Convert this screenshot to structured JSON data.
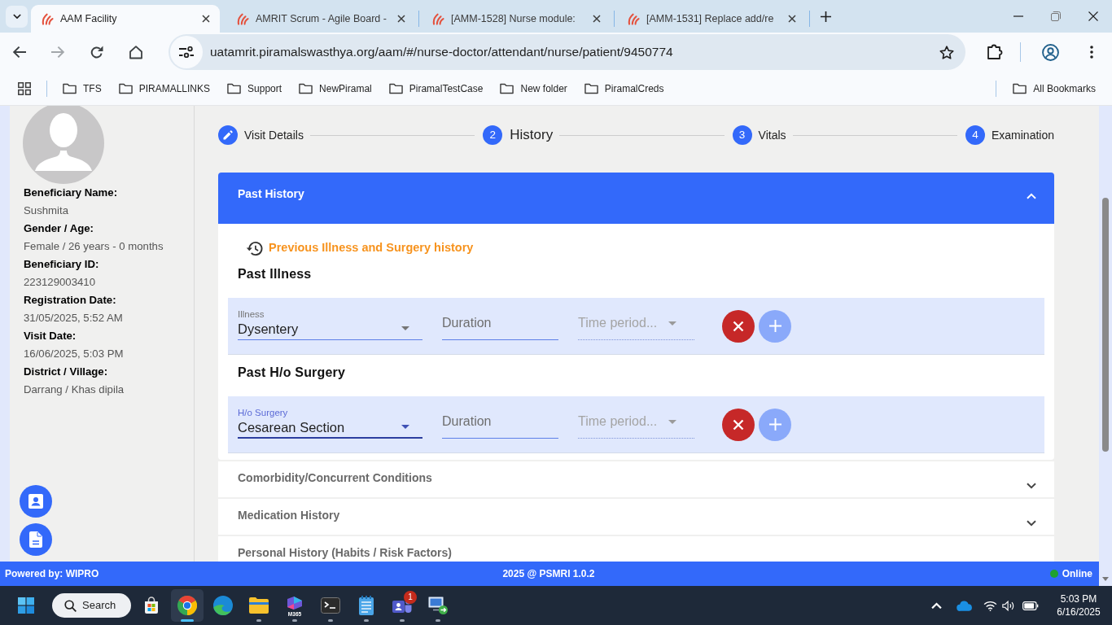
{
  "browser": {
    "tabs": [
      {
        "title": "AAM Facility",
        "selected": true
      },
      {
        "title": "AMRIT Scrum - Agile Board -",
        "selected": false
      },
      {
        "title": "[AMM-1528] Nurse module:",
        "selected": false
      },
      {
        "title": "[AMM-1531] Replace add/re",
        "selected": false
      }
    ],
    "nav_buttons": [
      {
        "kind": "back",
        "disabled": false
      },
      {
        "kind": "forward",
        "disabled": true
      },
      {
        "kind": "reload",
        "disabled": false
      },
      {
        "kind": "home",
        "disabled": false
      }
    ],
    "address": "uatamrit.piramalswasthya.org/aam/#/nurse-doctor/attendant/nurse/patient/9450774",
    "bookmarks": [
      "TFS",
      "PIRAMALLINKS",
      "Support",
      "NewPiramal",
      "PiramalTestCase",
      "New folder",
      "PiramalCreds"
    ],
    "all_bookmarks": "All Bookmarks"
  },
  "patient": {
    "details": [
      {
        "label": "Beneficiary Name:",
        "value": "Sushmita"
      },
      {
        "label": "Gender / Age:",
        "value": "Female / 26 years - 0 months"
      },
      {
        "label": "Beneficiary ID:",
        "value": "223129003410"
      },
      {
        "label": "Registration Date:",
        "value": "31/05/2025, 5:52 AM"
      },
      {
        "label": "Visit Date:",
        "value": "16/06/2025, 5:03 PM"
      },
      {
        "label": "District / Village:",
        "value": "Darrang / Khas dipila"
      }
    ],
    "actions": [
      {
        "kind": "profile"
      },
      {
        "kind": "document"
      }
    ]
  },
  "stepper": [
    {
      "kind": "edit",
      "label": "Visit Details",
      "selected": false
    },
    {
      "kind": "number",
      "number": "2",
      "label": "History",
      "selected": true
    },
    {
      "kind": "number",
      "number": "3",
      "label": "Vitals",
      "selected": false
    },
    {
      "kind": "number",
      "number": "4",
      "label": "Examination",
      "selected": false
    }
  ],
  "panels": [
    {
      "title": "Past History",
      "expanded": true,
      "history_link": "Previous Illness and Surgery history",
      "sections": [
        {
          "title": "Past Illness",
          "rows": [
            {
              "select": {
                "label": "Illness",
                "value": "Dysentery",
                "focused": false
              },
              "duration": {
                "placeholder": "Duration"
              },
              "time_period": {
                "placeholder": "Time period...",
                "disabled": true
              },
              "remove": {
                "disabled": false
              },
              "add": {
                "disabled": true
              }
            }
          ]
        },
        {
          "title": "Past H/o Surgery",
          "rows": [
            {
              "select": {
                "label": "H/o Surgery",
                "value": "Cesarean Section",
                "focused": true
              },
              "duration": {
                "placeholder": "Duration"
              },
              "time_period": {
                "placeholder": "Time period...",
                "disabled": true
              },
              "remove": {
                "disabled": false
              },
              "add": {
                "disabled": true
              }
            }
          ]
        }
      ]
    },
    {
      "title": "Comorbidity/Concurrent Conditions",
      "expanded": false
    },
    {
      "title": "Medication History",
      "expanded": false
    },
    {
      "title": "Personal History (Habits / Risk Factors)",
      "expanded": false
    }
  ],
  "footer": {
    "credit": "Powered by: WIPRO",
    "version": "2025 @ PSMRI 1.0.2",
    "status": "Online",
    "online": true
  },
  "taskbar": {
    "search": "Search",
    "apps": [
      {
        "kind": "store",
        "running": false,
        "active": false
      },
      {
        "kind": "chrome",
        "running": true,
        "active": true
      },
      {
        "kind": "edge",
        "running": false,
        "active": false
      },
      {
        "kind": "files",
        "running": true,
        "active": false
      },
      {
        "kind": "m365",
        "label": "M365",
        "running": true,
        "active": false
      },
      {
        "kind": "terminal",
        "running": true,
        "active": false
      },
      {
        "kind": "notepad",
        "running": true,
        "active": false
      },
      {
        "kind": "teams",
        "badge": "1",
        "running": true,
        "active": false
      },
      {
        "kind": "remote-desktop",
        "running": true,
        "active": false
      }
    ],
    "clock": {
      "time": "5:03 PM",
      "date": "6/16/2025"
    }
  }
}
